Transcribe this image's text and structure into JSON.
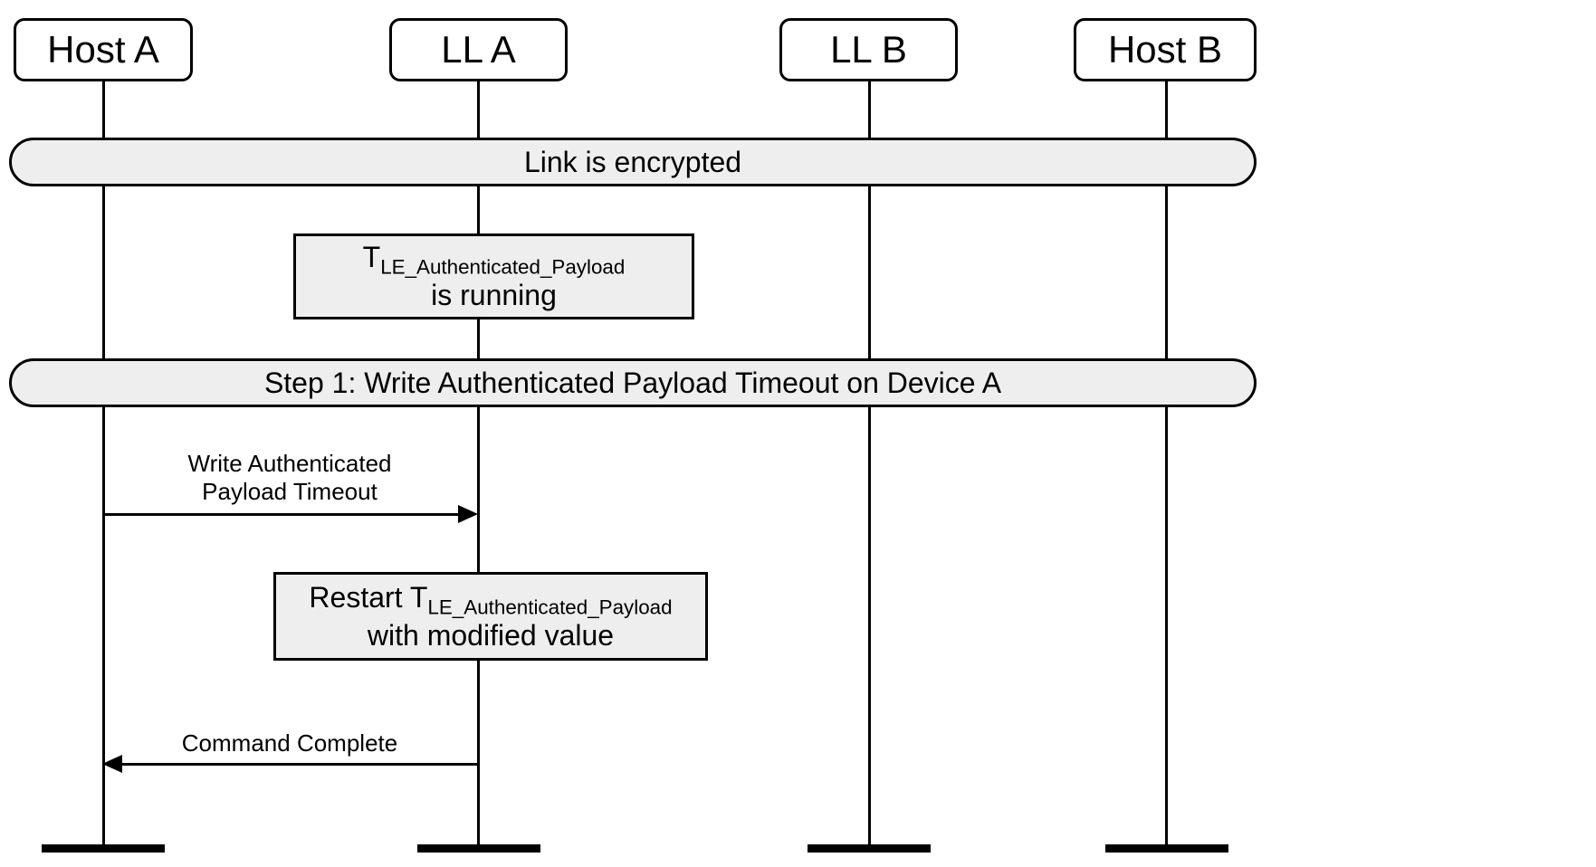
{
  "lanes": {
    "hostA": "Host A",
    "llA": "LL A",
    "llB": "LL B",
    "hostB": "Host B"
  },
  "bars": {
    "link_encrypted": "Link is encrypted",
    "step1": "Step 1:  Write Authenticated Payload Timeout on Device A"
  },
  "boxes": {
    "tle_running_part1": "T",
    "tle_running_sub": "LE_Authenticated_Payload",
    "tle_running_part2": "is running",
    "restart_part1": "Restart T",
    "restart_sub": "LE_Authenticated_Payload",
    "restart_part2": "with modified value"
  },
  "arrows": {
    "write_auth_line1": "Write Authenticated",
    "write_auth_line2": "Payload Timeout",
    "cmd_complete": "Command Complete"
  }
}
